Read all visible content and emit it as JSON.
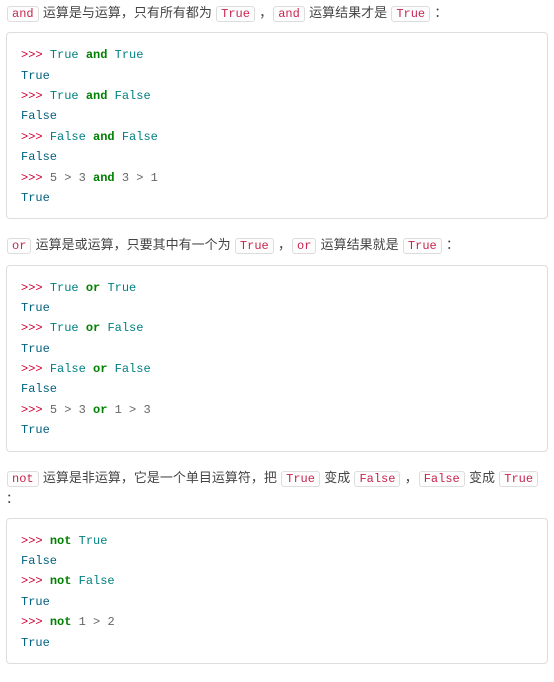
{
  "sections": [
    {
      "intro": [
        "and",
        " 运算是与运算，只有所有都为 ",
        "True",
        " ，",
        "and",
        " 运算结果才是 ",
        "True",
        " ："
      ],
      "code": [
        [
          {
            "t": ">>> ",
            "c": "prompt"
          },
          {
            "t": "True",
            "c": "bool"
          },
          {
            "t": " ",
            "c": ""
          },
          {
            "t": "and",
            "c": "kw"
          },
          {
            "t": " ",
            "c": ""
          },
          {
            "t": "True",
            "c": "bool"
          }
        ],
        [
          {
            "t": "True",
            "c": "out"
          }
        ],
        [
          {
            "t": ">>> ",
            "c": "prompt"
          },
          {
            "t": "True",
            "c": "bool"
          },
          {
            "t": " ",
            "c": ""
          },
          {
            "t": "and",
            "c": "kw"
          },
          {
            "t": " ",
            "c": ""
          },
          {
            "t": "False",
            "c": "bool"
          }
        ],
        [
          {
            "t": "False",
            "c": "out"
          }
        ],
        [
          {
            "t": ">>> ",
            "c": "prompt"
          },
          {
            "t": "False",
            "c": "bool"
          },
          {
            "t": " ",
            "c": ""
          },
          {
            "t": "and",
            "c": "kw"
          },
          {
            "t": " ",
            "c": ""
          },
          {
            "t": "False",
            "c": "bool"
          }
        ],
        [
          {
            "t": "False",
            "c": "out"
          }
        ],
        [
          {
            "t": ">>> ",
            "c": "prompt"
          },
          {
            "t": "5",
            "c": "num"
          },
          {
            "t": " > ",
            "c": "op"
          },
          {
            "t": "3",
            "c": "num"
          },
          {
            "t": " ",
            "c": ""
          },
          {
            "t": "and",
            "c": "kw"
          },
          {
            "t": " ",
            "c": ""
          },
          {
            "t": "3",
            "c": "num"
          },
          {
            "t": " > ",
            "c": "op"
          },
          {
            "t": "1",
            "c": "num"
          }
        ],
        [
          {
            "t": "True",
            "c": "out"
          }
        ]
      ]
    },
    {
      "intro": [
        "or",
        " 运算是或运算，只要其中有一个为 ",
        "True",
        " ，",
        "or",
        " 运算结果就是 ",
        "True",
        " ："
      ],
      "code": [
        [
          {
            "t": ">>> ",
            "c": "prompt"
          },
          {
            "t": "True",
            "c": "bool"
          },
          {
            "t": " ",
            "c": ""
          },
          {
            "t": "or",
            "c": "kw"
          },
          {
            "t": " ",
            "c": ""
          },
          {
            "t": "True",
            "c": "bool"
          }
        ],
        [
          {
            "t": "True",
            "c": "out"
          }
        ],
        [
          {
            "t": ">>> ",
            "c": "prompt"
          },
          {
            "t": "True",
            "c": "bool"
          },
          {
            "t": " ",
            "c": ""
          },
          {
            "t": "or",
            "c": "kw"
          },
          {
            "t": " ",
            "c": ""
          },
          {
            "t": "False",
            "c": "bool"
          }
        ],
        [
          {
            "t": "True",
            "c": "out"
          }
        ],
        [
          {
            "t": ">>> ",
            "c": "prompt"
          },
          {
            "t": "False",
            "c": "bool"
          },
          {
            "t": " ",
            "c": ""
          },
          {
            "t": "or",
            "c": "kw"
          },
          {
            "t": " ",
            "c": ""
          },
          {
            "t": "False",
            "c": "bool"
          }
        ],
        [
          {
            "t": "False",
            "c": "out"
          }
        ],
        [
          {
            "t": ">>> ",
            "c": "prompt"
          },
          {
            "t": "5",
            "c": "num"
          },
          {
            "t": " > ",
            "c": "op"
          },
          {
            "t": "3",
            "c": "num"
          },
          {
            "t": " ",
            "c": ""
          },
          {
            "t": "or",
            "c": "kw"
          },
          {
            "t": " ",
            "c": ""
          },
          {
            "t": "1",
            "c": "num"
          },
          {
            "t": " > ",
            "c": "op"
          },
          {
            "t": "3",
            "c": "num"
          }
        ],
        [
          {
            "t": "True",
            "c": "out"
          }
        ]
      ]
    },
    {
      "intro": [
        "not",
        " 运算是非运算，它是一个单目运算符，把 ",
        "True",
        " 变成 ",
        "False",
        " ，",
        "False",
        " 变成 ",
        "True",
        " ："
      ],
      "code": [
        [
          {
            "t": ">>> ",
            "c": "prompt"
          },
          {
            "t": "not",
            "c": "kw"
          },
          {
            "t": " ",
            "c": ""
          },
          {
            "t": "True",
            "c": "bool"
          }
        ],
        [
          {
            "t": "False",
            "c": "out"
          }
        ],
        [
          {
            "t": ">>> ",
            "c": "prompt"
          },
          {
            "t": "not",
            "c": "kw"
          },
          {
            "t": " ",
            "c": ""
          },
          {
            "t": "False",
            "c": "bool"
          }
        ],
        [
          {
            "t": "True",
            "c": "out"
          }
        ],
        [
          {
            "t": ">>> ",
            "c": "prompt"
          },
          {
            "t": "not",
            "c": "kw"
          },
          {
            "t": " ",
            "c": ""
          },
          {
            "t": "1",
            "c": "num"
          },
          {
            "t": " > ",
            "c": "op"
          },
          {
            "t": "2",
            "c": "num"
          }
        ],
        [
          {
            "t": "True",
            "c": "out"
          }
        ]
      ]
    }
  ]
}
